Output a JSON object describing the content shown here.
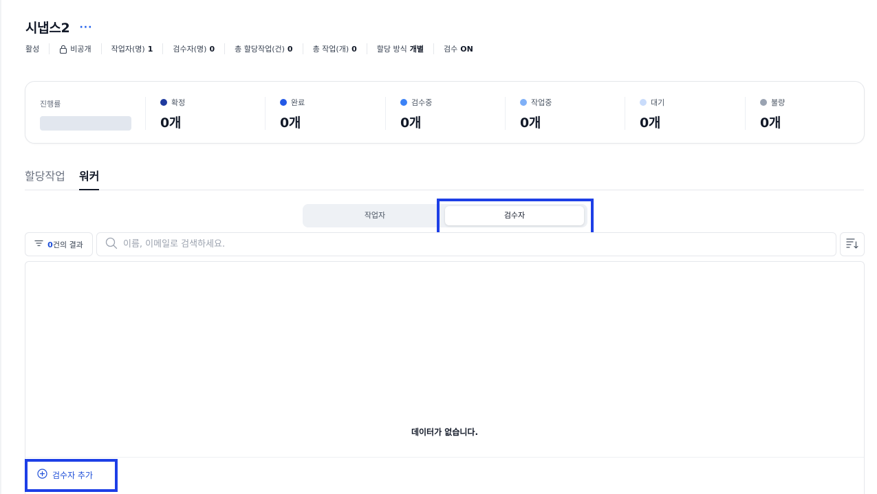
{
  "header": {
    "title": "시냅스2",
    "more_label": "···"
  },
  "meta": {
    "status": "활성",
    "visibility": "비공개",
    "workers_label": "작업자(명)",
    "workers_value": "1",
    "reviewers_label": "검수자(명)",
    "reviewers_value": "0",
    "total_assign_label": "총 할당작업(건)",
    "total_assign_value": "0",
    "total_tasks_label": "총 작업(개)",
    "total_tasks_value": "0",
    "assign_method_label": "할당 방식",
    "assign_method_value": "개별",
    "review_label": "검수",
    "review_value": "ON"
  },
  "stats": {
    "progress_label": "진행률",
    "items": [
      {
        "label": "확정",
        "value": "0개",
        "color": "#1e3a9e"
      },
      {
        "label": "완료",
        "value": "0개",
        "color": "#2459e6"
      },
      {
        "label": "검수중",
        "value": "0개",
        "color": "#3b82f6"
      },
      {
        "label": "작업중",
        "value": "0개",
        "color": "#7fb0f7"
      },
      {
        "label": "대기",
        "value": "0개",
        "color": "#c9dcfb"
      },
      {
        "label": "불량",
        "value": "0개",
        "color": "#9aa3b2"
      }
    ]
  },
  "tabs": {
    "assign": "할당작업",
    "worker": "워커"
  },
  "segment": {
    "worker": "작업자",
    "reviewer": "검수자"
  },
  "filter": {
    "count": "0",
    "suffix": "건의 결과"
  },
  "search": {
    "placeholder": "이름, 이메일로 검색하세요."
  },
  "table": {
    "empty_message": "데이터가 없습니다."
  },
  "actions": {
    "add_reviewer": "검수자 추가"
  },
  "colors": {
    "accent": "#1d4ed8",
    "highlight": "#1d3fe6"
  }
}
